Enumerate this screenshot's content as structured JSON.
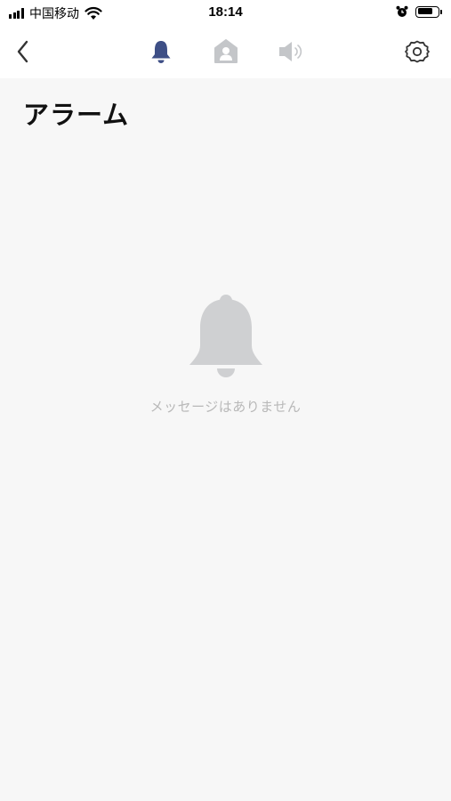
{
  "status_bar": {
    "carrier": "中国移动",
    "time": "18:14",
    "battery_level": 0.8,
    "icons": [
      "signal-icon",
      "wifi-icon",
      "alarm-clock-icon",
      "battery-icon"
    ]
  },
  "nav": {
    "back_icon": "chevron-left-icon",
    "tabs": [
      {
        "icon": "bell-icon",
        "active": true
      },
      {
        "icon": "person-icon",
        "active": false
      },
      {
        "icon": "speaker-icon",
        "active": false
      }
    ],
    "settings_icon": "gear-icon"
  },
  "page": {
    "title": "アラーム"
  },
  "empty_state": {
    "icon": "bell-icon",
    "message": "メッセージはありません"
  },
  "colors": {
    "active_tab": "#3e4f86",
    "inactive_tab": "#c4c6c9",
    "empty_icon": "#cfd0d2",
    "empty_text": "#b8b8b8",
    "background": "#f7f7f7"
  }
}
